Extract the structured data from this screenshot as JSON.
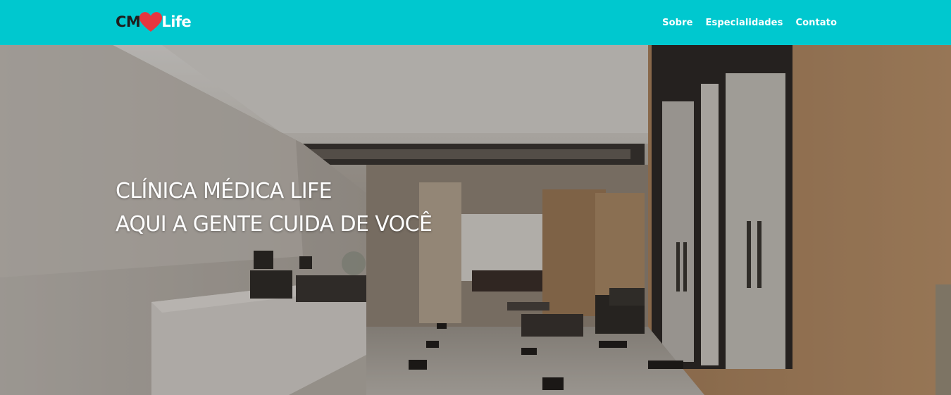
{
  "brand": {
    "logo_prefix": "CM",
    "logo_suffix": "Life",
    "heart_icon": "heart-icon",
    "heart_color": "#e8363f",
    "nav_bg_color": "#00c8cf"
  },
  "nav": {
    "items": [
      {
        "label": "Sobre"
      },
      {
        "label": "Especialidades"
      },
      {
        "label": "Contato"
      }
    ]
  },
  "hero": {
    "title_line1": "CLÍNICA MÉDICA LIFE",
    "title_line2": "AQUI A GENTE CUIDA DE VOCÊ",
    "background_image": "clinic-lobby-photo"
  }
}
